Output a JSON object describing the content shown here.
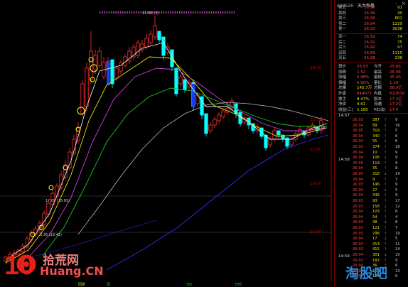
{
  "window": {
    "code": "600526",
    "name": "天大恒基",
    "minimize_glyph": "–",
    "close_glyph": "×"
  },
  "chart": {
    "price_axis_labels": [
      "28.00",
      "25.00",
      "22.00",
      "19.00",
      "16.00",
      "13.00"
    ],
    "annotations": {
      "high": "31.56 (3)",
      "marker_a": "17.09 (18.85)",
      "marker_b": "3.36 (19.42)",
      "current_mark": "26.96"
    },
    "bottom_labels": [
      "同步",
      "周",
      "日K",
      "分时"
    ]
  },
  "order_book": {
    "asks": [
      {
        "label": "卖五",
        "price": "26.97",
        "vol": "91"
      },
      {
        "label": "卖四",
        "price": "26.96",
        "vol": "40"
      },
      {
        "label": "卖三",
        "price": "26.95",
        "vol": "801"
      },
      {
        "label": "卖二",
        "price": "26.94",
        "vol": "1229"
      },
      {
        "label": "卖一",
        "price": "26.93",
        "vol": "3036"
      }
    ],
    "bids": [
      {
        "label": "买一",
        "price": "26.92",
        "vol": "74"
      },
      {
        "label": "买二",
        "price": "26.91",
        "vol": "75"
      },
      {
        "label": "买三",
        "price": "26.90",
        "vol": "97"
      },
      {
        "label": "买四",
        "price": "26.89",
        "vol": "1115"
      },
      {
        "label": "买五",
        "price": "26.88",
        "vol": "236"
      }
    ]
  },
  "quote": {
    "rows": [
      {
        "l1": "现价",
        "v1": "26.93",
        "l2": "今开",
        "v2": "25.60"
      },
      {
        "l1": "涨跌",
        "v1": "1.52",
        "l2": "最高",
        "v2": "26.98"
      },
      {
        "l1": "涨幅",
        "v1": "5.98%",
        "l2": "最低",
        "v2": "25.40"
      },
      {
        "l1": "振幅",
        "v1": "6.60%",
        "l2": "量比",
        "v2": "1.10"
      },
      {
        "l1": "总量",
        "v1": "145.7万",
        "l2": "总额",
        "v2": "38.9亿"
      },
      {
        "l1": "外盘",
        "v1": "844677",
        "l2": "内盘",
        "v2": "612839"
      },
      {
        "l1": "换手",
        "v1": "8.47%",
        "l2": "股本",
        "v2": "17.2亿"
      },
      {
        "l1": "净资",
        "v1": "4.61",
        "l2": "流通",
        "v2": "17.2亿"
      },
      {
        "l1": "收益(三)",
        "v1": "1.160",
        "l2": "PE(动)",
        "v2": "17.4"
      }
    ]
  },
  "ticks": {
    "time_top": "14:57",
    "time_mid": "14:58",
    "time_bot": "14:59",
    "rows": [
      {
        "p": "26.93",
        "v": "287",
        "n": "9"
      },
      {
        "p": "26.94",
        "v": "89",
        "n": "16"
      },
      {
        "p": "26.95",
        "v": "319",
        "n": "5"
      },
      {
        "p": "26.94",
        "v": "340",
        "n": "6"
      },
      {
        "p": "26.93",
        "v": "55",
        "n": "6"
      },
      {
        "p": "26.93",
        "v": "374",
        "n": "18"
      },
      {
        "p": "26.94",
        "v": "10",
        "n": "9"
      },
      {
        "p": "26.94",
        "v": "106",
        "n": "9"
      },
      {
        "p": "26.95",
        "v": "119",
        "n": "9"
      },
      {
        "p": "26.94",
        "v": "35",
        "n": "8"
      },
      {
        "p": "26.95",
        "v": "218",
        "n": "19"
      },
      {
        "p": "26.94",
        "v": "9",
        "n": "7"
      },
      {
        "p": "26.93",
        "v": "146",
        "n": "9"
      },
      {
        "p": "26.94",
        "v": "27",
        "n": "5"
      },
      {
        "p": "26.93",
        "v": "345",
        "n": "9"
      },
      {
        "p": "26.93",
        "v": "93",
        "n": "17"
      },
      {
        "p": "26.93",
        "v": "158",
        "n": "12"
      },
      {
        "p": "26.94",
        "v": "103",
        "n": "6"
      },
      {
        "p": "26.94",
        "v": "54",
        "n": "4"
      },
      {
        "p": "26.93",
        "v": "38",
        "n": "8"
      },
      {
        "p": "26.93",
        "v": "121",
        "n": "7"
      },
      {
        "p": "26.93",
        "v": "298",
        "n": "19"
      },
      {
        "p": "26.94",
        "v": "17",
        "n": "5"
      },
      {
        "p": "26.93",
        "v": "413",
        "n": "11"
      },
      {
        "p": "26.93",
        "v": "415",
        "n": "14"
      },
      {
        "p": "26.94",
        "v": "301",
        "n": "15"
      },
      {
        "p": "26.93",
        "v": "182",
        "n": "9"
      },
      {
        "p": "26.94",
        "v": "36",
        "n": "6"
      },
      {
        "p": "26.93",
        "v": "160",
        "n": "13"
      },
      {
        "p": "26.94",
        "v": "129",
        "n": "6"
      },
      {
        "p": "26.93",
        "v": "116",
        "n": "14"
      },
      {
        "p": "26.93",
        "v": "203",
        "n": "8"
      },
      {
        "p": "26.92",
        "v": "1",
        "n": "1"
      },
      {
        "p": "26.93",
        "v": "73",
        "n": "5"
      },
      {
        "p": "26.93",
        "v": "148",
        "n": "6"
      }
    ]
  },
  "watermarks": {
    "left_number": "10",
    "left_cn": "拾荒网",
    "left_en": "Huang.CN",
    "right_cn": "淘股吧"
  },
  "colors": {
    "up": "#ff3030",
    "down": "#00ffff",
    "axis": "#a00000",
    "volume": "#e6e600"
  }
}
